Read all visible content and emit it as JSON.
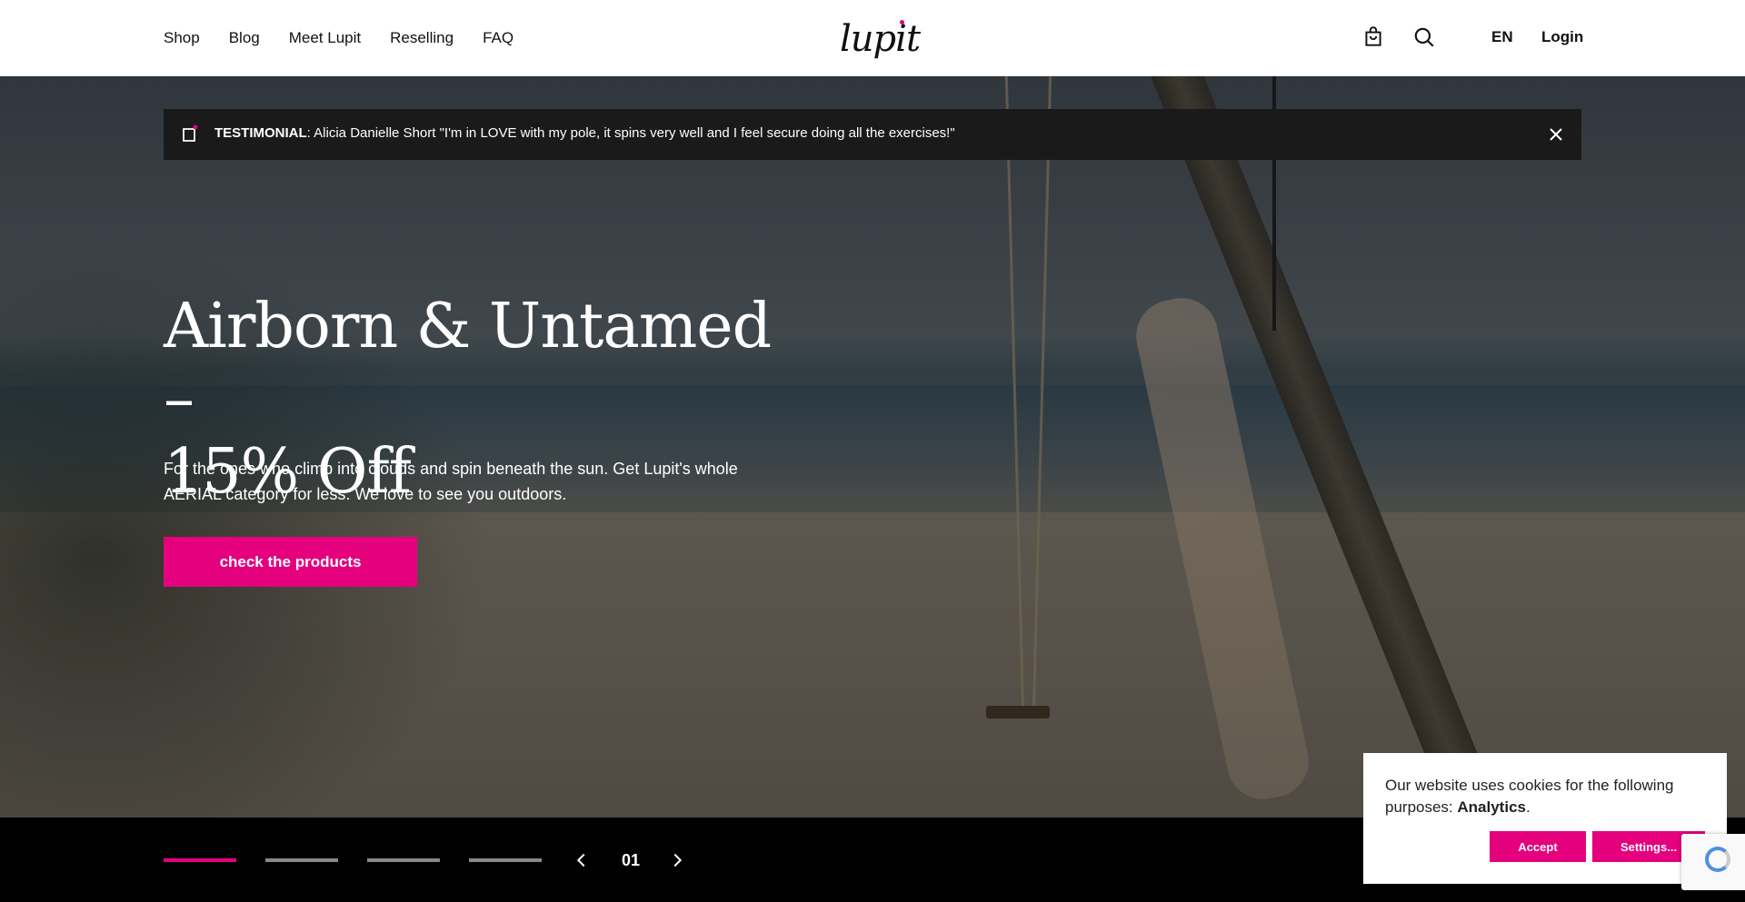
{
  "header": {
    "nav": [
      "Shop",
      "Blog",
      "Meet Lupit",
      "Reselling",
      "FAQ"
    ],
    "logo_text": "lupit",
    "language": "EN",
    "login": "Login",
    "icons": [
      "cart-icon",
      "search-icon"
    ]
  },
  "testimonial": {
    "label": "TESTIMONIAL",
    "text": ": Alicia Danielle Short \"I'm in LOVE with my pole, it spins very well and I feel secure doing all the exercises!\""
  },
  "hero": {
    "title_line1": "Airborn & Untamed –",
    "title_line2": "15% Off",
    "description_line1": "For the ones who climb into clouds and spin beneath the sun. Get Lupit's whole",
    "description_line2": "AERIAL category for less. We love to see you outdoors.",
    "cta": "check the products"
  },
  "slider": {
    "slide_count": 4,
    "active_index": 0,
    "counter": "01"
  },
  "cookie": {
    "text": "Our website uses cookies for the following purposes: ",
    "purpose": "Analytics",
    "after": ".",
    "accept": "Accept",
    "settings": "Settings..."
  },
  "colors": {
    "accent": "#e5007e",
    "banner_bg": "#1a1a1a",
    "header_bg": "#ffffff"
  }
}
